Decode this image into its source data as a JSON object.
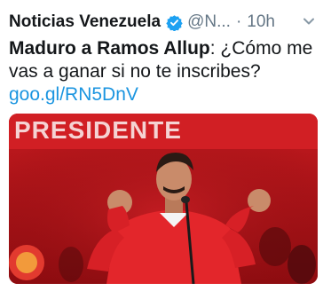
{
  "tweet": {
    "author_name": "Noticias Venezuela",
    "handle": "@N...",
    "separator": "·",
    "timestamp": "10h",
    "text_bold": "Maduro a Ramos Allup",
    "text_rest": ": ¿Cómo me vas a ganar si no te inscribes?",
    "link": "goo.gl/RN5DnV"
  },
  "media": {
    "banner_text": "PRESIDENTE"
  },
  "colors": {
    "accent": "#1b95e0",
    "secondary_text": "#657786",
    "banner_red": "#b3141a"
  },
  "icons": {
    "verified": "verified-badge-icon",
    "caret": "chevron-down-icon"
  }
}
